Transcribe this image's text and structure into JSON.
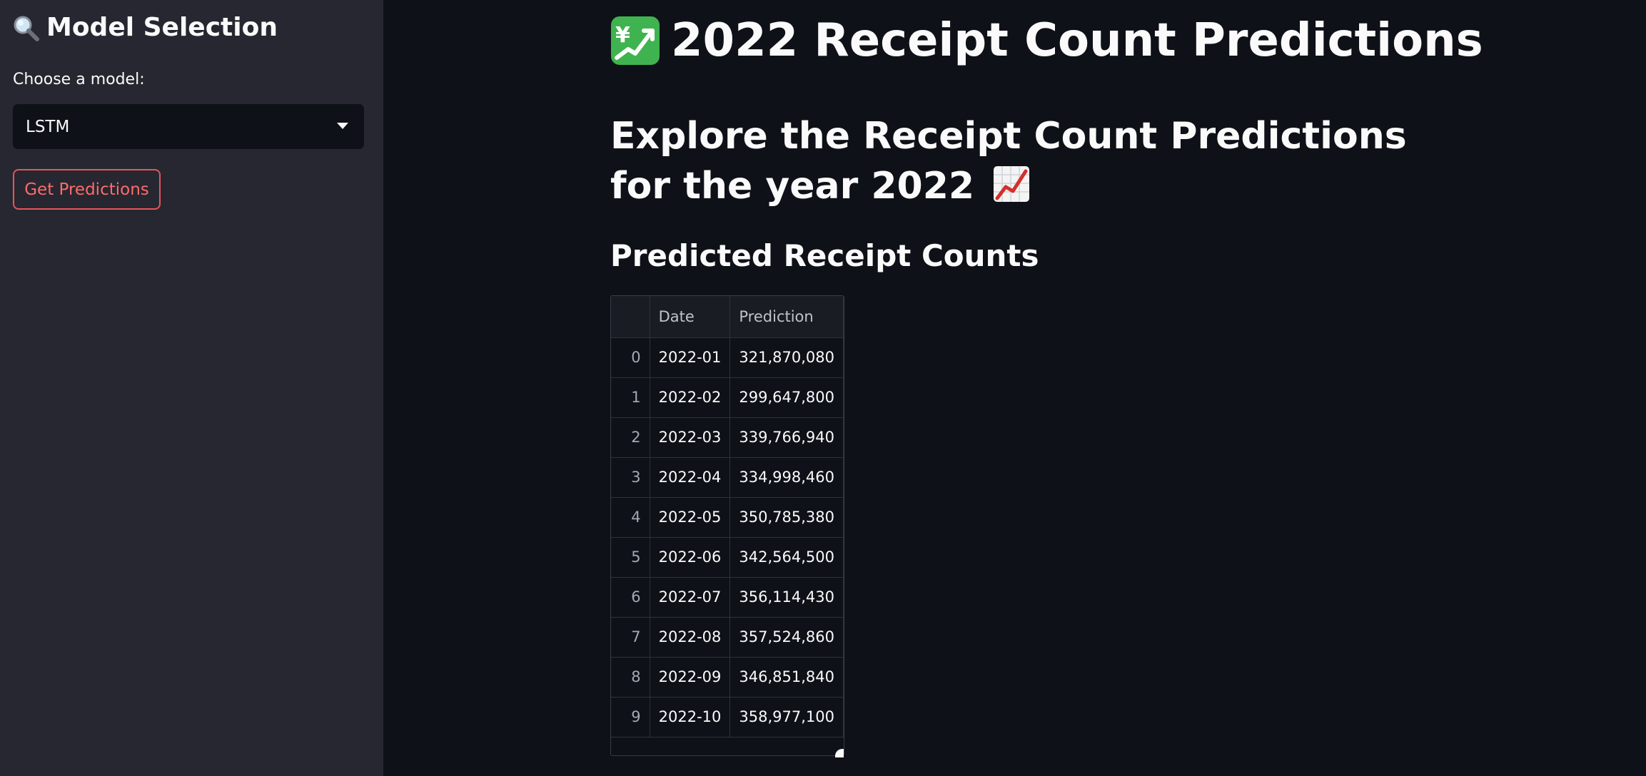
{
  "sidebar": {
    "title": "Model Selection",
    "title_icon": "magnifier-icon",
    "choose_label": "Choose a model:",
    "selected_model": "LSTM",
    "button_label": "Get Predictions"
  },
  "main": {
    "title": "2022 Receipt Count Predictions",
    "title_icon": "chart-yen-icon",
    "subheading": "Explore the Receipt Count Predictions for the year 2022",
    "subheading_icon": "chart-increasing-icon",
    "table_heading": "Predicted Receipt Counts"
  },
  "table": {
    "columns": [
      "",
      "Date",
      "Prediction"
    ],
    "rows": [
      {
        "index": "0",
        "date": "2022-01",
        "prediction": "321,870,080"
      },
      {
        "index": "1",
        "date": "2022-02",
        "prediction": "299,647,800"
      },
      {
        "index": "2",
        "date": "2022-03",
        "prediction": "339,766,940"
      },
      {
        "index": "3",
        "date": "2022-04",
        "prediction": "334,998,460"
      },
      {
        "index": "4",
        "date": "2022-05",
        "prediction": "350,785,380"
      },
      {
        "index": "5",
        "date": "2022-06",
        "prediction": "342,564,500"
      },
      {
        "index": "6",
        "date": "2022-07",
        "prediction": "356,114,430"
      },
      {
        "index": "7",
        "date": "2022-08",
        "prediction": "357,524,860"
      },
      {
        "index": "8",
        "date": "2022-09",
        "prediction": "346,851,840"
      },
      {
        "index": "9",
        "date": "2022-10",
        "prediction": "358,977,100"
      }
    ]
  },
  "colors": {
    "sidebar_bg": "#262730",
    "main_bg": "#0e1117",
    "accent": "#ff6b6b"
  }
}
